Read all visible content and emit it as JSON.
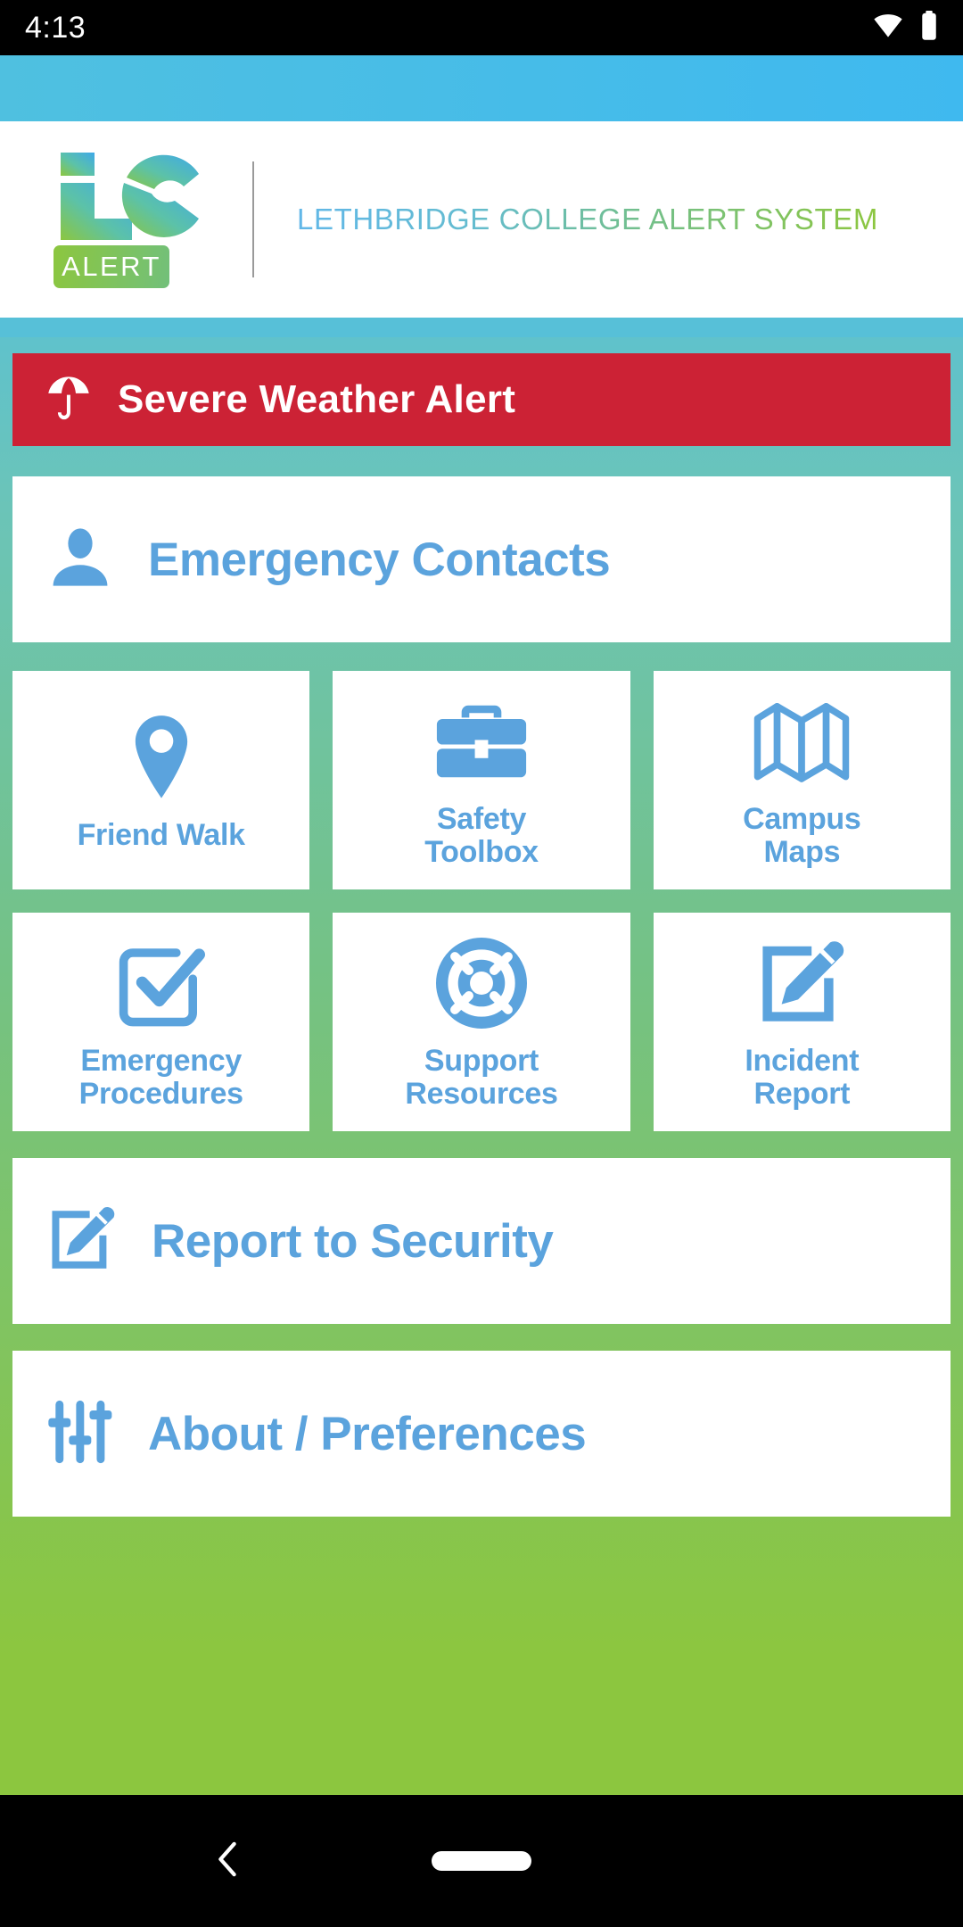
{
  "status_bar": {
    "time": "4:13",
    "icons": [
      "wifi-icon",
      "battery-icon"
    ]
  },
  "header": {
    "logo_lc_text": "LC",
    "logo_badge_text": "ALERT",
    "title": "LETHBRIDGE COLLEGE ALERT SYSTEM",
    "gradient_start": "#61b7e8",
    "gradient_end": "#8cc63f"
  },
  "alert_banner": {
    "label": "Severe Weather Alert",
    "icon": "umbrella-icon",
    "color": "#cc2235"
  },
  "emergency_contacts": {
    "label": "Emergency Contacts",
    "icon": "person-icon"
  },
  "grid": {
    "tiles": [
      {
        "label": "Friend Walk",
        "icon": "map-pin-icon"
      },
      {
        "label": "Safety\nToolbox",
        "icon": "briefcase-icon",
        "line1": "Safety",
        "line2": "Toolbox"
      },
      {
        "label": "Campus\nMaps",
        "icon": "map-icon",
        "line1": "Campus",
        "line2": "Maps"
      },
      {
        "label": "Emergency\nProcedures",
        "icon": "checkbox-icon",
        "line1": "Emergency",
        "line2": "Procedures"
      },
      {
        "label": "Support\nResources",
        "icon": "lifebuoy-icon",
        "line1": "Support",
        "line2": "Resources"
      },
      {
        "label": "Incident\nReport",
        "icon": "edit-square-icon",
        "line1": "Incident",
        "line2": "Report"
      }
    ]
  },
  "report_security": {
    "label": "Report to Security",
    "icon": "edit-square-icon"
  },
  "about_preferences": {
    "label": "About / Preferences",
    "icon": "sliders-icon"
  },
  "nav_bar": {
    "back_icon": "back-chevron-icon",
    "home_pill": "home-pill-icon"
  },
  "theme": {
    "accent_blue": "#5ba3dd",
    "brand_green": "#8cc63f",
    "brand_cyan": "#3fb9ef",
    "alert_red": "#cc2235"
  }
}
